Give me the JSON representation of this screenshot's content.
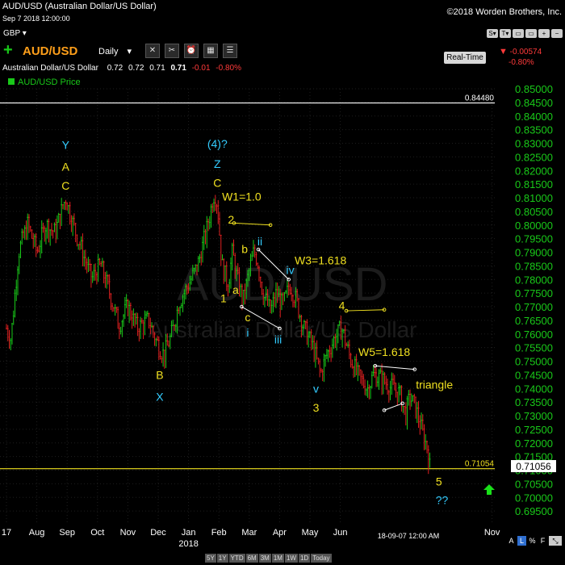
{
  "header": {
    "title": "AUD/USD (Australian Dollar/US Dollar)",
    "date": "Sep 7 2018 12:00:00",
    "copyright": "©2018 Worden Brothers, Inc.",
    "currency": "GBP ▾"
  },
  "toolbar": {
    "symbol": "AUD/USD",
    "period": "Daily",
    "period_arrow": "▾",
    "buttons": [
      "S▾",
      "T▾",
      "▭",
      "▭",
      "+",
      "−"
    ]
  },
  "quote": {
    "name": "Australian Dollar/US Dollar",
    "open": "0.72",
    "high": "0.72",
    "low": "0.71",
    "close": "0.71",
    "change": "-0.01",
    "change_pct": "-0.80%"
  },
  "realtime": {
    "label": "Real-Time",
    "change": "-0.00574",
    "change_pct": "-0.80%"
  },
  "series_label": "AUD/USD Price",
  "watermark": {
    "symbol": "AUD/USD",
    "name": "Australian Dollar/US Dollar"
  },
  "range_buttons": [
    "5Y",
    "1Y",
    "YTD",
    "6M",
    "3M",
    "1M",
    "1W",
    "1D",
    "Today"
  ],
  "scale_buttons": [
    "A",
    "L",
    "%",
    "F"
  ],
  "crosshair_date": "18-09-07 12:00 AM",
  "colors": {
    "up": "#19c919",
    "down": "#e02020",
    "yellow": "#f0e020",
    "cyan": "#33ccff",
    "white": "#ffffff"
  },
  "chart_data": {
    "type": "candlestick",
    "title": "AUD/USD Price",
    "ylim": [
      0.69,
      0.85
    ],
    "yticks": [
      "0.85000",
      "0.84500",
      "0.84000",
      "0.83500",
      "0.83000",
      "0.82500",
      "0.82000",
      "0.81500",
      "0.81000",
      "0.80500",
      "0.80000",
      "0.79500",
      "0.79000",
      "0.78500",
      "0.78000",
      "0.77500",
      "0.77000",
      "0.76500",
      "0.76000",
      "0.75500",
      "0.75000",
      "0.74500",
      "0.74000",
      "0.73500",
      "0.73000",
      "0.72500",
      "0.72000",
      "0.71500",
      "0.71000",
      "0.70500",
      "0.70000",
      "0.69500"
    ],
    "x_tick_labels": [
      {
        "label": "17",
        "month": 0
      },
      {
        "label": "Aug",
        "month": 1
      },
      {
        "label": "Sep",
        "month": 2
      },
      {
        "label": "Oct",
        "month": 3
      },
      {
        "label": "Nov",
        "month": 4
      },
      {
        "label": "Dec",
        "month": 5
      },
      {
        "label": "Jan",
        "month": 6,
        "sub": "2018"
      },
      {
        "label": "Feb",
        "month": 7
      },
      {
        "label": "Mar",
        "month": 8
      },
      {
        "label": "Apr",
        "month": 9
      },
      {
        "label": "May",
        "month": 10
      },
      {
        "label": "Jun",
        "month": 11
      },
      {
        "label": "Nov",
        "month": 16
      }
    ],
    "price_path": [
      [
        0.0,
        0.762
      ],
      [
        0.15,
        0.758
      ],
      [
        0.4,
        0.79
      ],
      [
        0.7,
        0.8
      ],
      [
        1.0,
        0.79
      ],
      [
        1.3,
        0.8
      ],
      [
        1.6,
        0.797
      ],
      [
        1.95,
        0.81
      ],
      [
        2.2,
        0.8
      ],
      [
        2.5,
        0.79
      ],
      [
        2.8,
        0.78
      ],
      [
        3.1,
        0.785
      ],
      [
        3.4,
        0.775
      ],
      [
        3.7,
        0.763
      ],
      [
        4.0,
        0.77
      ],
      [
        4.3,
        0.762
      ],
      [
        4.7,
        0.765
      ],
      [
        4.9,
        0.758
      ],
      [
        5.2,
        0.752
      ],
      [
        5.45,
        0.76
      ],
      [
        5.7,
        0.772
      ],
      [
        6.0,
        0.778
      ],
      [
        6.3,
        0.785
      ],
      [
        6.6,
        0.798
      ],
      [
        6.85,
        0.812
      ],
      [
        6.95,
        0.808
      ],
      [
        7.1,
        0.785
      ],
      [
        7.3,
        0.778
      ],
      [
        7.45,
        0.79
      ],
      [
        7.6,
        0.78
      ],
      [
        7.8,
        0.772
      ],
      [
        8.0,
        0.783
      ],
      [
        8.15,
        0.79
      ],
      [
        8.25,
        0.788
      ],
      [
        8.45,
        0.775
      ],
      [
        8.7,
        0.768
      ],
      [
        8.9,
        0.775
      ],
      [
        9.1,
        0.77
      ],
      [
        9.35,
        0.778
      ],
      [
        9.55,
        0.772
      ],
      [
        9.8,
        0.762
      ],
      [
        10.1,
        0.755
      ],
      [
        10.35,
        0.745
      ],
      [
        10.55,
        0.752
      ],
      [
        10.8,
        0.758
      ],
      [
        11.05,
        0.762
      ],
      [
        11.3,
        0.752
      ],
      [
        11.6,
        0.744
      ],
      [
        11.9,
        0.74
      ],
      [
        12.1,
        0.745
      ],
      [
        12.4,
        0.743
      ],
      [
        12.7,
        0.74
      ],
      [
        12.95,
        0.738
      ],
      [
        13.15,
        0.73
      ],
      [
        13.3,
        0.737
      ],
      [
        13.5,
        0.732
      ],
      [
        13.75,
        0.722
      ],
      [
        13.85,
        0.719
      ],
      [
        13.95,
        0.711
      ]
    ],
    "hlines": [
      {
        "value": 0.8448,
        "label": "0.84480",
        "color": "white"
      },
      {
        "value": 0.71054,
        "label": "0.71054",
        "color": "yellow"
      }
    ],
    "last_price": "0.71056",
    "segments": [
      {
        "from": [
          7.5,
          0.8007
        ],
        "to": [
          8.7,
          0.8
        ],
        "color": "yellow"
      },
      {
        "from": [
          11.2,
          0.7685
        ],
        "to": [
          12.45,
          0.7689
        ],
        "color": "yellow"
      },
      {
        "from": [
          8.3,
          0.791
        ],
        "to": [
          9.3,
          0.78
        ],
        "color": "white"
      },
      {
        "from": [
          7.75,
          0.77
        ],
        "to": [
          9.0,
          0.762
        ],
        "color": "white"
      },
      {
        "from": [
          12.15,
          0.7483
        ],
        "to": [
          13.45,
          0.747
        ],
        "color": "white"
      },
      {
        "from": [
          12.45,
          0.732
        ],
        "to": [
          13.05,
          0.7345
        ],
        "color": "white"
      }
    ],
    "annotations": [
      {
        "text": "Y",
        "at": [
          1.95,
          0.828
        ],
        "color": "cyan"
      },
      {
        "text": "A",
        "at": [
          1.95,
          0.82
        ],
        "color": "yellow"
      },
      {
        "text": "C",
        "at": [
          1.95,
          0.813
        ],
        "color": "yellow"
      },
      {
        "text": "B",
        "at": [
          5.05,
          0.7435
        ],
        "color": "yellow"
      },
      {
        "text": "X",
        "at": [
          5.05,
          0.7355
        ],
        "color": "cyan"
      },
      {
        "text": "(4)?",
        "at": [
          6.95,
          0.8283
        ],
        "color": "cyan"
      },
      {
        "text": "Z",
        "at": [
          6.95,
          0.821
        ],
        "color": "cyan"
      },
      {
        "text": "C",
        "at": [
          6.95,
          0.814
        ],
        "color": "yellow"
      },
      {
        "text": "W1=1.0",
        "at": [
          7.75,
          0.809
        ],
        "color": "yellow"
      },
      {
        "text": "2",
        "at": [
          7.4,
          0.8005
        ],
        "color": "yellow"
      },
      {
        "text": "b",
        "at": [
          7.85,
          0.7897
        ],
        "color": "yellow"
      },
      {
        "text": "ii",
        "at": [
          8.35,
          0.7925
        ],
        "color": "cyan"
      },
      {
        "text": "iv",
        "at": [
          9.35,
          0.782
        ],
        "color": "cyan"
      },
      {
        "text": "W3=1.618",
        "at": [
          10.35,
          0.7855
        ],
        "color": "yellow"
      },
      {
        "text": "a",
        "at": [
          7.55,
          0.7747
        ],
        "color": "yellow"
      },
      {
        "text": "1",
        "at": [
          7.15,
          0.7717
        ],
        "color": "yellow"
      },
      {
        "text": "c",
        "at": [
          7.95,
          0.7647
        ],
        "color": "yellow"
      },
      {
        "text": "i",
        "at": [
          7.95,
          0.759
        ],
        "color": "cyan"
      },
      {
        "text": "iii",
        "at": [
          8.95,
          0.7565
        ],
        "color": "cyan"
      },
      {
        "text": "4",
        "at": [
          11.05,
          0.769
        ],
        "color": "yellow"
      },
      {
        "text": "W5=1.618",
        "at": [
          12.45,
          0.752
        ],
        "color": "yellow"
      },
      {
        "text": "triangle",
        "at": [
          14.1,
          0.74
        ],
        "color": "yellow"
      },
      {
        "text": "v",
        "at": [
          10.2,
          0.7385
        ],
        "color": "cyan"
      },
      {
        "text": "3",
        "at": [
          10.2,
          0.7315
        ],
        "color": "yellow"
      },
      {
        "text": "5",
        "at": [
          14.25,
          0.7043
        ],
        "color": "yellow"
      },
      {
        "text": "??",
        "at": [
          14.35,
          0.6975
        ],
        "color": "cyan"
      }
    ]
  }
}
